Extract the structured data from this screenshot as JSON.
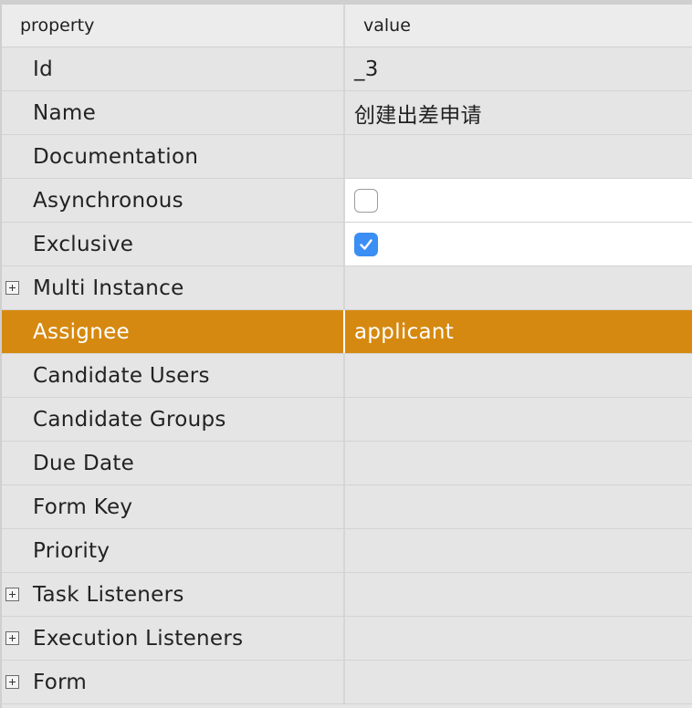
{
  "header": {
    "property_label": "property",
    "value_label": "value"
  },
  "rows": [
    {
      "name": "Id",
      "value": "_3",
      "type": "text"
    },
    {
      "name": "Name",
      "value": "创建出差申请",
      "type": "text"
    },
    {
      "name": "Documentation",
      "value": "",
      "type": "text"
    },
    {
      "name": "Asynchronous",
      "value": false,
      "type": "checkbox"
    },
    {
      "name": "Exclusive",
      "value": true,
      "type": "checkbox"
    },
    {
      "name": "Multi Instance",
      "value": "",
      "type": "group"
    },
    {
      "name": "Assignee",
      "value": "applicant",
      "type": "text",
      "selected": true
    },
    {
      "name": "Candidate Users",
      "value": "",
      "type": "text"
    },
    {
      "name": "Candidate Groups",
      "value": "",
      "type": "text"
    },
    {
      "name": "Due Date",
      "value": "",
      "type": "text"
    },
    {
      "name": "Form Key",
      "value": "",
      "type": "text"
    },
    {
      "name": "Priority",
      "value": "",
      "type": "text"
    },
    {
      "name": "Task Listeners",
      "value": "",
      "type": "group"
    },
    {
      "name": "Execution Listeners",
      "value": "",
      "type": "group"
    },
    {
      "name": "Form",
      "value": "",
      "type": "group"
    }
  ],
  "icons": {
    "expand": "plus-box-icon",
    "check": "checkmark-icon"
  },
  "colors": {
    "selected_row": "#d68910",
    "checkbox_checked": "#3b8ef3"
  }
}
